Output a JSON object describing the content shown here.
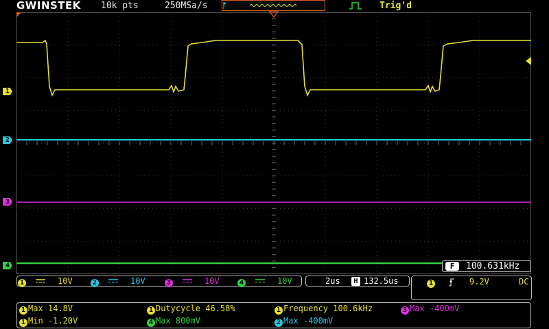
{
  "header": {
    "brand": "GWINSTEK",
    "record_length": "10k pts",
    "sample_rate": "250MSa/s",
    "trigger_status": "Trig'd"
  },
  "channels": [
    {
      "id": "1",
      "color": "#e8e030",
      "scale": "10V"
    },
    {
      "id": "2",
      "color": "#28c8e0",
      "scale": "10V"
    },
    {
      "id": "3",
      "color": "#e030e0",
      "scale": "10V"
    },
    {
      "id": "4",
      "color": "#30d040",
      "scale": "10V"
    }
  ],
  "horizontal": {
    "timebase": "2us",
    "position_icon": "H",
    "position": "132.5us"
  },
  "trigger": {
    "source": "1",
    "slope_icon": "rising-edge-icon",
    "level": "9.2V",
    "coupling": "DC"
  },
  "frequency_counter": {
    "badge": "F",
    "value": "100.631kHz"
  },
  "measurements": {
    "ch1_max": {
      "ch": "1",
      "text": "Max 14.8V"
    },
    "ch1_min": {
      "ch": "1",
      "text": "Min -1.20V"
    },
    "ch1_duty": {
      "ch": "1",
      "text": "Dutycycle 46.58%"
    },
    "ch4_max": {
      "ch": "4",
      "text": "Max 800mV"
    },
    "ch1_freq": {
      "ch": "1",
      "text": "Frequency 100.6kHz"
    },
    "ch2_max": {
      "ch": "2",
      "text": "Max -400mV"
    },
    "ch3_max": {
      "ch": "3",
      "text": "Max -400mV"
    }
  },
  "colors": {
    "grid": "#3a3a3a",
    "accent": "#e0601a",
    "panel_border": "#bbbbbb"
  }
}
